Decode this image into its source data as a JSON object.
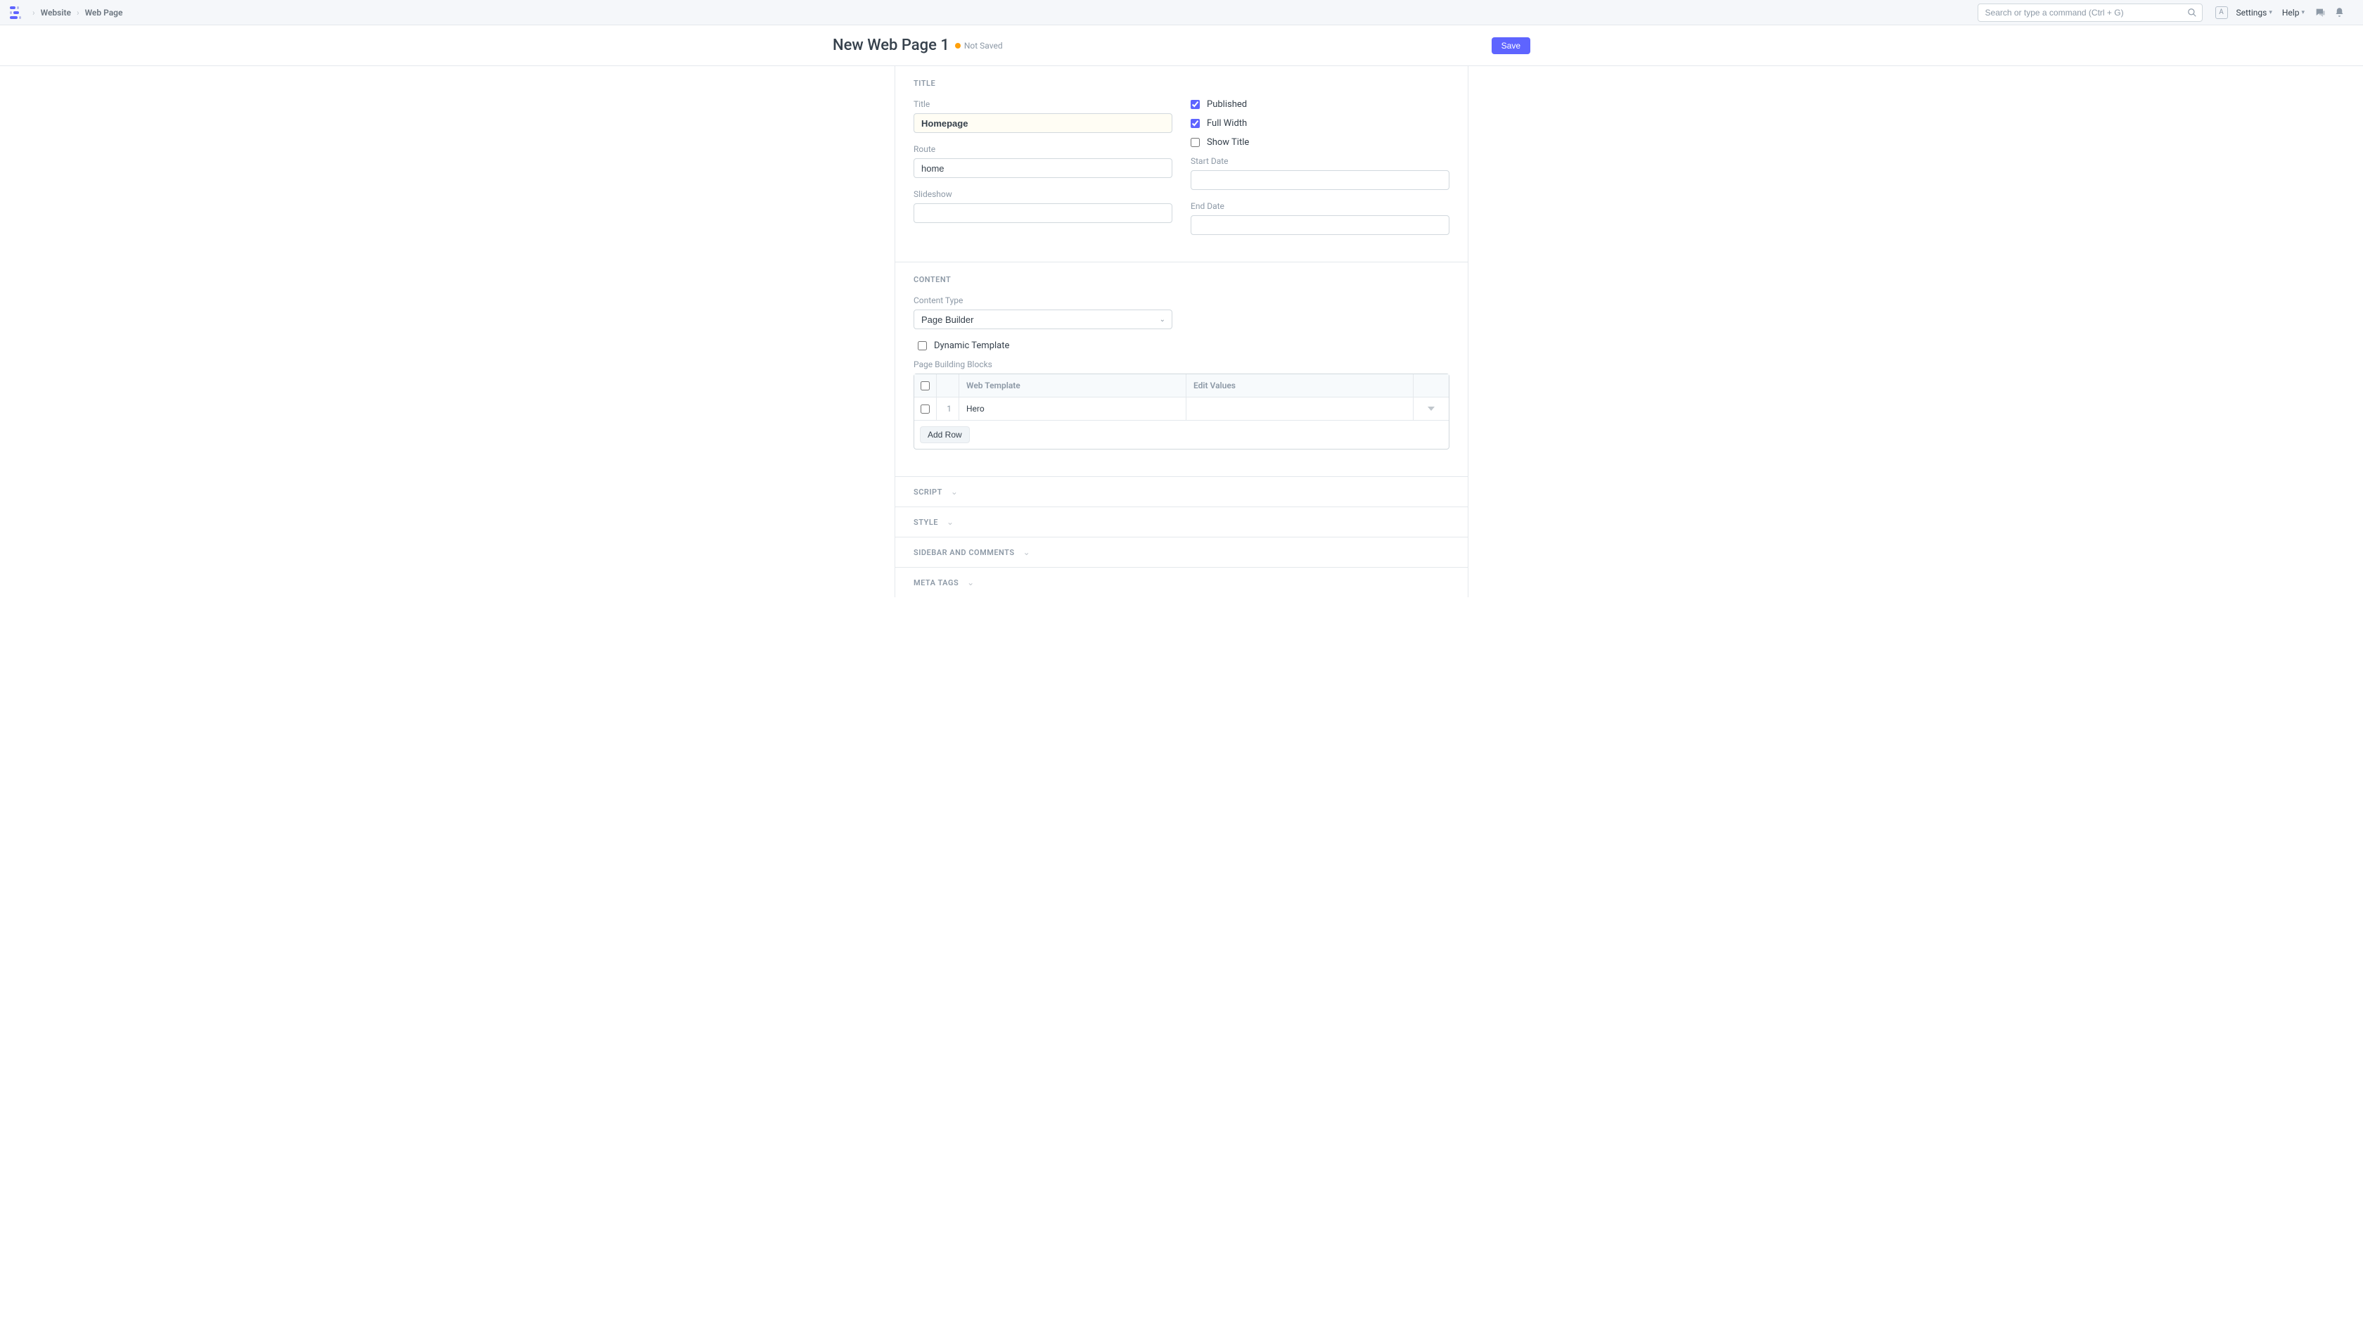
{
  "breadcrumb": {
    "items": [
      "Website",
      "Web Page"
    ]
  },
  "search": {
    "placeholder": "Search or type a command (Ctrl + G)"
  },
  "nav": {
    "avatar": "A",
    "settings": "Settings",
    "help": "Help"
  },
  "page": {
    "title": "New Web Page 1",
    "status": "Not Saved",
    "save": "Save"
  },
  "sections": {
    "title": {
      "head": "Title",
      "title_label": "Title",
      "title_value": "Homepage",
      "route_label": "Route",
      "route_value": "home",
      "slideshow_label": "Slideshow",
      "slideshow_value": "",
      "published": "Published",
      "full_width": "Full Width",
      "show_title": "Show Title",
      "start_date_label": "Start Date",
      "start_date_value": "",
      "end_date_label": "End Date",
      "end_date_value": ""
    },
    "content": {
      "head": "Content",
      "content_type_label": "Content Type",
      "content_type_value": "Page Builder",
      "dynamic_template": "Dynamic Template",
      "blocks_label": "Page Building Blocks",
      "grid_head_template": "Web Template",
      "grid_head_edit": "Edit Values",
      "rows": [
        {
          "idx": "1",
          "template": "Hero",
          "edit": ""
        }
      ],
      "add_row": "Add Row"
    },
    "script": "Script",
    "style": "Style",
    "sidebar": "Sidebar and Comments",
    "meta": "Meta Tags"
  }
}
